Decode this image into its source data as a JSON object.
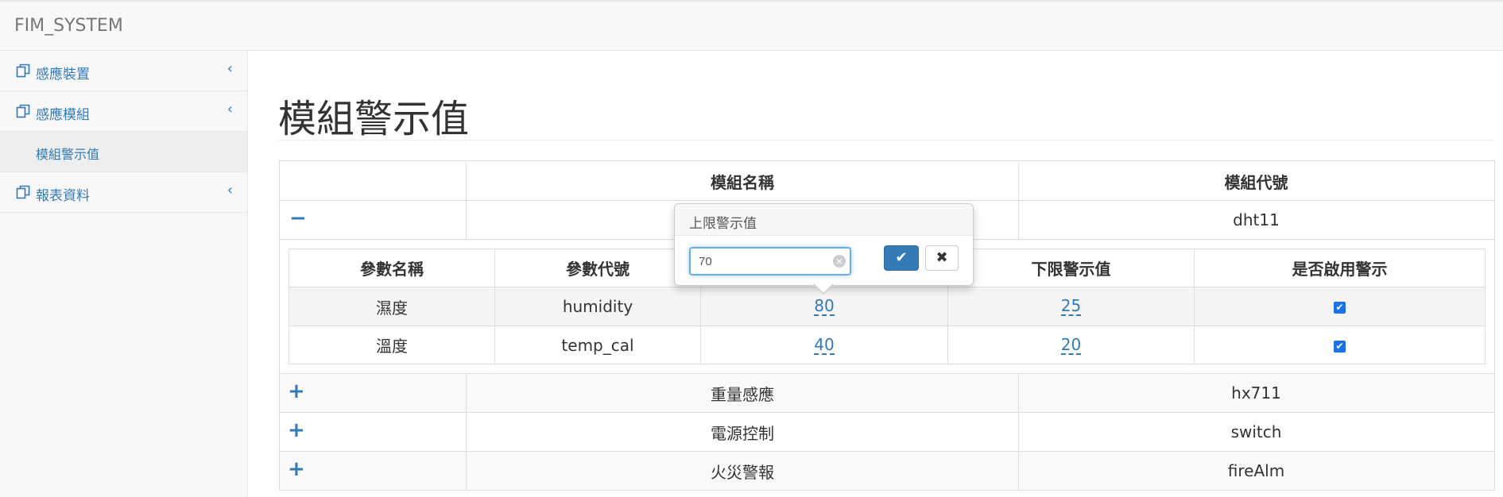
{
  "brand": "FIM_SYSTEM",
  "sidebar": {
    "items": [
      {
        "label": "感應裝置",
        "icon": "copy-icon",
        "chevron": "‹"
      },
      {
        "label": "感應模組",
        "icon": "copy-icon",
        "chevron": "‹"
      },
      {
        "label": "模組警示值"
      },
      {
        "label": "報表資料",
        "icon": "copy-icon",
        "chevron": "‹"
      }
    ]
  },
  "page": {
    "title": "模組警示值"
  },
  "modules_table": {
    "headers": [
      "模組名稱",
      "模組代號"
    ],
    "rows": [
      {
        "toggle": "−",
        "name": "",
        "code": "dht11"
      },
      {
        "toggle": "+",
        "name": "重量感應",
        "code": "hx711"
      },
      {
        "toggle": "+",
        "name": "電源控制",
        "code": "switch"
      },
      {
        "toggle": "+",
        "name": "火災警報",
        "code": "fireAlm"
      }
    ]
  },
  "params_table": {
    "headers": [
      "參數名稱",
      "參數代號",
      "",
      "下限警示值",
      "是否啟用警示"
    ],
    "rows": [
      {
        "name": "濕度",
        "code": "humidity",
        "upper": "80",
        "lower": "25",
        "enabled": true
      },
      {
        "name": "溫度",
        "code": "temp_cal",
        "upper": "40",
        "lower": "20",
        "enabled": true
      }
    ]
  },
  "popover": {
    "title": "上限警示值",
    "input_value": "70",
    "confirm_icon": "check-icon",
    "cancel_icon": "close-icon"
  },
  "colors": {
    "accent": "#337ab7",
    "checkbox": "#1a73e8",
    "border": "#dddddd"
  }
}
